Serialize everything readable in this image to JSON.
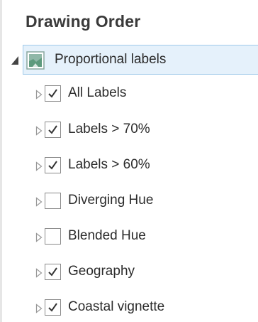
{
  "panel": {
    "title": "Drawing Order"
  },
  "map": {
    "label": "Proportional labels",
    "expanded": true,
    "selected": true,
    "icon": "map-icon"
  },
  "layers": [
    {
      "label": "All Labels",
      "checked": true
    },
    {
      "label": "Labels > 70%",
      "checked": true
    },
    {
      "label": "Labels > 60%",
      "checked": true
    },
    {
      "label": "Diverging Hue",
      "checked": false
    },
    {
      "label": "Blended Hue",
      "checked": false
    },
    {
      "label": "Geography",
      "checked": true
    },
    {
      "label": "Coastal vignette",
      "checked": true
    }
  ],
  "colors": {
    "selection_fill": "#e5f1fb",
    "selection_border": "#9fcaea",
    "checkbox_border": "#8a8a8a",
    "checkmark": "#333333",
    "expander": "#9a9a9a"
  }
}
